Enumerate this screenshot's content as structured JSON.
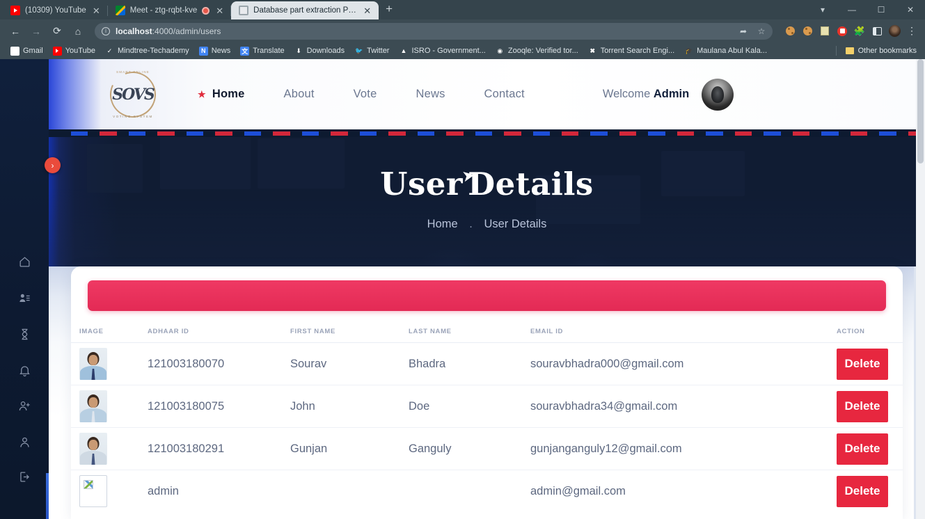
{
  "browser": {
    "tabs": [
      {
        "title": "(10309) YouTube",
        "favicon": "youtube-icon",
        "active": false,
        "recording": false
      },
      {
        "title": "Meet - ztg-rqbt-kve",
        "favicon": "google-meet-icon",
        "active": false,
        "recording": true
      },
      {
        "title": "Database part extraction Page",
        "favicon": "globe-icon",
        "active": true,
        "recording": false
      }
    ],
    "new_tab_label": "+",
    "close_label": "✕",
    "window_controls": [
      "chevron-down-icon",
      "minimize-icon",
      "maximize-icon",
      "close-icon"
    ],
    "nav": {
      "back": "←",
      "forward": "→",
      "reload": "⟳",
      "home": "⌂"
    },
    "omnibox": {
      "host": "localhost",
      "path": ":4000/admin/users",
      "info_icon": "ⓘ",
      "share_icon": "share-icon",
      "star_icon": "☆"
    },
    "toolbar_icons": [
      "extension-cookie-icon",
      "cookie-icon",
      "notepad-icon",
      "record-icon",
      "extensions-puzzle-icon",
      "side-panel-icon",
      "profile-avatar-icon",
      "chrome-menu-icon"
    ],
    "bookmarks": [
      {
        "label": "Gmail",
        "icon": "gmail-icon"
      },
      {
        "label": "YouTube",
        "icon": "youtube-icon"
      },
      {
        "label": "Mindtree-Techademy",
        "icon": "check-icon"
      },
      {
        "label": "News",
        "icon": "news-icon"
      },
      {
        "label": "Translate",
        "icon": "translate-icon"
      },
      {
        "label": "Downloads",
        "icon": "download-icon"
      },
      {
        "label": "Twitter",
        "icon": "twitter-icon"
      },
      {
        "label": "ISRO - Government...",
        "icon": "isro-icon"
      },
      {
        "label": "Zooqle: Verified tor...",
        "icon": "zooqle-icon"
      },
      {
        "label": "Torrent Search Engi...",
        "icon": "torrent-icon"
      },
      {
        "label": "Maulana Abul Kala...",
        "icon": "graduation-icon"
      }
    ],
    "other_bookmarks": "Other bookmarks"
  },
  "sidebar": {
    "items": [
      {
        "name": "home",
        "icon": "home-icon"
      },
      {
        "name": "user-list",
        "icon": "user-list-icon"
      },
      {
        "name": "pending",
        "icon": "hourglass-icon"
      },
      {
        "name": "notifications",
        "icon": "bell-icon"
      },
      {
        "name": "add-user",
        "icon": "add-user-icon"
      },
      {
        "name": "profile",
        "icon": "user-icon"
      },
      {
        "name": "logout",
        "icon": "logout-icon"
      }
    ],
    "toggle_icon": "›"
  },
  "site_header": {
    "logo": {
      "monogram": "SOVS",
      "top_text": "SMART ONLINE",
      "bottom_text": "VOTING SYSTEM"
    },
    "nav": [
      {
        "label": "Home",
        "active": true,
        "icon": "star-icon"
      },
      {
        "label": "About",
        "active": false
      },
      {
        "label": "Vote",
        "active": false
      },
      {
        "label": "News",
        "active": false
      },
      {
        "label": "Contact",
        "active": false
      }
    ],
    "welcome_prefix": "Welcome",
    "welcome_user": "Admin",
    "avatar": "user-avatar"
  },
  "hero": {
    "title_part1": "User",
    "title_part2": "Details",
    "breadcrumb": {
      "home": "Home",
      "separator": ".",
      "current": "User Details"
    }
  },
  "table": {
    "headers": [
      "IMAGE",
      "ADHAAR ID",
      "FIRST NAME",
      "LAST NAME",
      "EMAIL ID",
      "ACTION"
    ],
    "rows": [
      {
        "image": "user-photo",
        "adhaar_id": "121003180070",
        "first_name": "Sourav",
        "last_name": "Bhadra",
        "email": "souravbhadra000@gmail.com",
        "action": "Delete"
      },
      {
        "image": "user-photo",
        "adhaar_id": "121003180075",
        "first_name": "John",
        "last_name": "Doe",
        "email": "souravbhadra34@gmail.com",
        "action": "Delete"
      },
      {
        "image": "user-photo",
        "adhaar_id": "121003180291",
        "first_name": "Gunjan",
        "last_name": "Ganguly",
        "email": "gunjanganguly12@gmail.com",
        "action": "Delete"
      },
      {
        "image": "broken-image",
        "adhaar_id": "admin",
        "first_name": "",
        "last_name": "",
        "email": "admin@gmail.com",
        "action": "Delete"
      }
    ]
  },
  "colors": {
    "accent_red": "#e7273f",
    "alert_pink": "#e32a55",
    "navy": "#101c33",
    "stripe_blue": "#1d4ed8",
    "stripe_red": "#d3273a"
  }
}
